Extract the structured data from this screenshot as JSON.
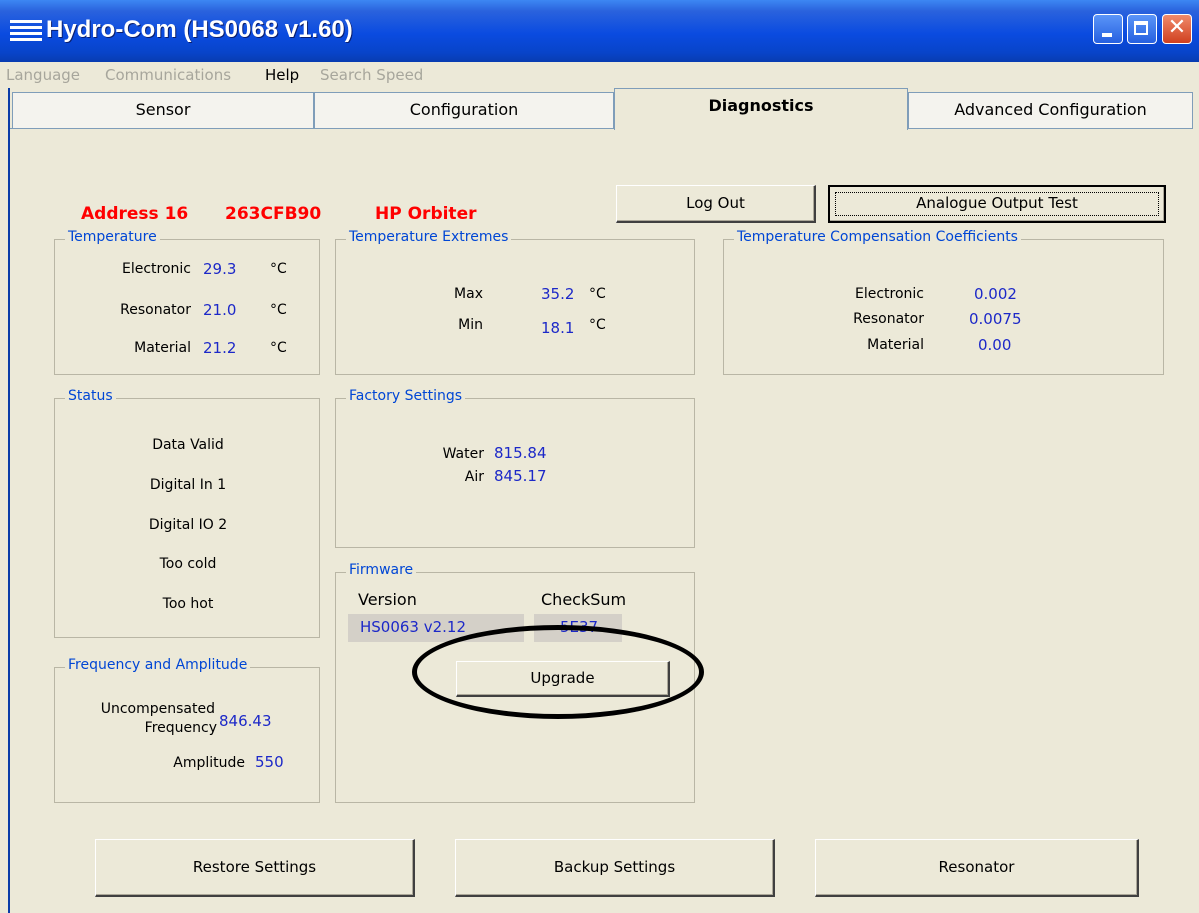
{
  "window": {
    "title": "Hydro-Com (HS0068 v1.60)"
  },
  "menu": [
    {
      "label": "Language",
      "enabled": false
    },
    {
      "label": "Communications",
      "enabled": false
    },
    {
      "label": "Help",
      "enabled": true
    },
    {
      "label": "Search Speed",
      "enabled": false
    }
  ],
  "tabs": [
    "Sensor",
    "Configuration",
    "Diagnostics",
    "Advanced Configuration"
  ],
  "active_tab": "Diagnostics",
  "sensor_info": {
    "address": "Address 16",
    "serial": "263CFB90",
    "model": "HP Orbiter"
  },
  "buttons": {
    "log_out": "Log Out",
    "analogue_output_test": "Analogue Output Test",
    "upgrade": "Upgrade",
    "restore_settings": "Restore Settings",
    "backup_settings": "Backup Settings",
    "resonator": "Resonator"
  },
  "temperature": {
    "title": "Temperature",
    "unit": "°C",
    "rows": [
      {
        "label": "Electronic",
        "value": "29.3"
      },
      {
        "label": "Resonator",
        "value": "21.0"
      },
      {
        "label": "Material",
        "value": "21.2"
      }
    ]
  },
  "temperature_extremes": {
    "title": "Temperature Extremes",
    "unit": "°C",
    "max_label": "Max",
    "max": "35.2",
    "min_label": "Min",
    "min": "18.1"
  },
  "compensation": {
    "title": "Temperature Compensation Coefficients",
    "rows": [
      {
        "label": "Electronic",
        "value": "0.002"
      },
      {
        "label": "Resonator",
        "value": "0.0075"
      },
      {
        "label": "Material",
        "value": "0.00"
      }
    ]
  },
  "status": {
    "title": "Status",
    "items": [
      "Data Valid",
      "Digital In 1",
      "Digital IO 2",
      "Too cold",
      "Too hot"
    ]
  },
  "factory_settings": {
    "title": "Factory Settings",
    "water_label": "Water",
    "water": "815.84",
    "air_label": "Air",
    "air": "845.17"
  },
  "firmware": {
    "title": "Firmware",
    "version_label": "Version",
    "version": "HS0063 v2.12",
    "checksum_label": "CheckSum",
    "checksum": "5E37"
  },
  "frequency": {
    "title": "Frequency and Amplitude",
    "uncomp_label_line1": "Uncompensated",
    "uncomp_label_line2": "Frequency",
    "uncomp_value": "846.43",
    "amplitude_label": "Amplitude",
    "amplitude_value": "550"
  }
}
